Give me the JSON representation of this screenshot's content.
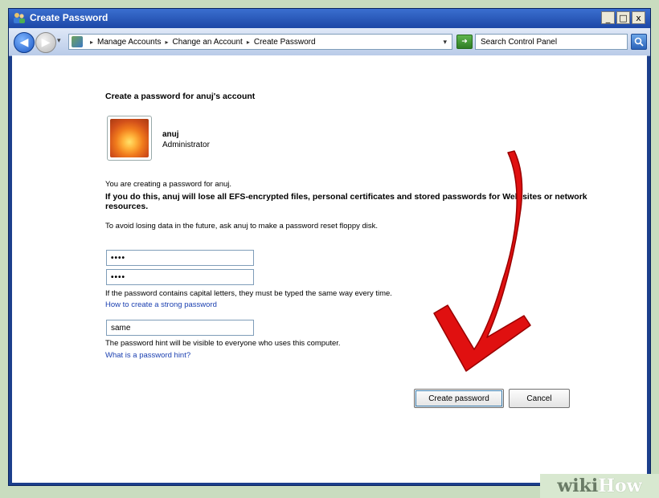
{
  "window": {
    "title": "Create Password",
    "controls": {
      "minimize": "_",
      "maximize": "□",
      "close": "x"
    }
  },
  "address_bar": {
    "crumbs": [
      "Manage Accounts",
      "Change an Account",
      "Create Password"
    ],
    "separator": "▸",
    "search_placeholder": "Search Control Panel"
  },
  "content": {
    "heading": "Create a password for anuj's account",
    "user": {
      "name": "anuj",
      "role": "Administrator"
    },
    "info_line": "You are creating a password for anuj.",
    "warning": "If you do this, anuj will lose all EFS-encrypted files, personal certificates and stored passwords for Web sites or network resources.",
    "advice": "To avoid losing data in the future, ask anuj to make a password reset floppy disk.",
    "password_value": "••••",
    "confirm_value": "••••",
    "case_note": "If the password contains capital letters, they must be typed the same way every time.",
    "strong_link": "How to create a strong password",
    "hint_value": "same",
    "hint_note": "The password hint will be visible to everyone who uses this computer.",
    "hint_link": "What is a password hint?",
    "create_button": "Create password",
    "cancel_button": "Cancel"
  },
  "watermark": {
    "part1": "wiki",
    "part2": "How"
  },
  "colors": {
    "arrow": "#e01010",
    "link": "#1a3fb0",
    "titlebar": "#1c47a6"
  },
  "icons": [
    "users-icon",
    "back-arrow-icon",
    "forward-arrow-icon",
    "control-panel-icon",
    "go-icon",
    "search-icon"
  ]
}
